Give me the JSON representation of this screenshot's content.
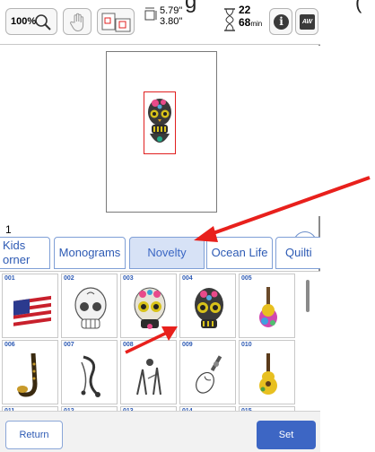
{
  "toolbar": {
    "zoom_label": "100%",
    "size_width": "5.79\"",
    "size_height": "3.80\"",
    "color_count": "22",
    "time_value": "68",
    "time_unit": "min",
    "info_label": "i",
    "machine_label": "AW"
  },
  "page_number": "1",
  "tabs": [
    {
      "label_line1": "Kids",
      "label_line2": "orner"
    },
    {
      "label": "Monograms"
    },
    {
      "label": "Novelty",
      "selected": true
    },
    {
      "label": "Ocean Life"
    },
    {
      "label": "Quilti"
    }
  ],
  "designs": [
    {
      "num": "001",
      "icon": "american-flag-icon"
    },
    {
      "num": "002",
      "icon": "sugar-skull-white-icon"
    },
    {
      "num": "003",
      "icon": "sugar-skull-color-icon"
    },
    {
      "num": "004",
      "icon": "sugar-skull-dark-icon"
    },
    {
      "num": "005",
      "icon": "guitar-floral-icon"
    },
    {
      "num": "006",
      "icon": "saxophone-icon"
    },
    {
      "num": "007",
      "icon": "music-notes-swirl-icon"
    },
    {
      "num": "008",
      "icon": "hands-music-icon"
    },
    {
      "num": "009",
      "icon": "violin-floral-icon"
    },
    {
      "num": "010",
      "icon": "guitar-yellow-icon"
    },
    {
      "num": "011"
    },
    {
      "num": "012"
    },
    {
      "num": "013"
    },
    {
      "num": "014"
    },
    {
      "num": "015"
    }
  ],
  "footer": {
    "return_label": "Return",
    "set_label": "Set"
  },
  "overlay": {
    "cropped_text": "g",
    "cropped_paren": "("
  },
  "colors": {
    "accent_blue": "#3d66c4",
    "tab_selected_bg": "#d7e2f6",
    "annotation_red": "#e8201c"
  }
}
